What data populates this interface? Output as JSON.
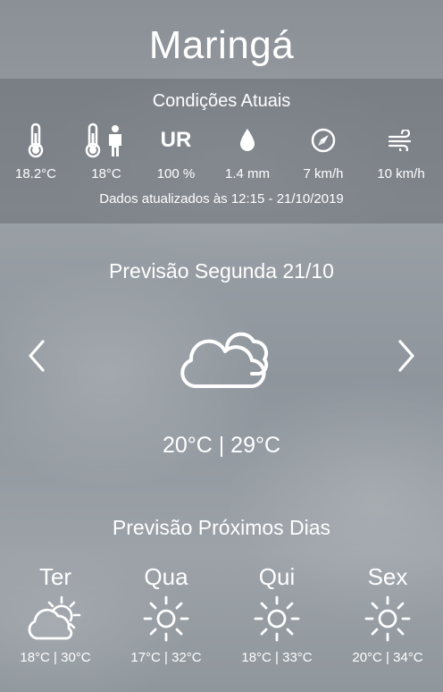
{
  "city": "Maringá",
  "current": {
    "title": "Condições Atuais",
    "metrics": [
      {
        "icon": "thermometer-icon",
        "value": "18.2°C"
      },
      {
        "icon": "feels-like-icon",
        "value": "18°C"
      },
      {
        "icon": "humidity-ur-icon",
        "label": "UR",
        "value": "100 %"
      },
      {
        "icon": "rain-drop-icon",
        "value": "1.4 mm"
      },
      {
        "icon": "wind-direction-icon",
        "value": "7 km/h"
      },
      {
        "icon": "wind-gust-icon",
        "value": "10 km/h"
      }
    ],
    "updated": "Dados atualizados às 12:15 - 21/10/2019"
  },
  "forecast": {
    "title": "Previsão Segunda 21/10",
    "icon": "cloudy-icon",
    "temps": "20°C | 29°C"
  },
  "next_days": {
    "title": "Previsão Próximos Dias",
    "days": [
      {
        "name": "Ter",
        "icon": "partly-cloudy-icon",
        "range": "18°C | 30°C"
      },
      {
        "name": "Qua",
        "icon": "sun-icon",
        "range": "17°C | 32°C"
      },
      {
        "name": "Qui",
        "icon": "sun-icon",
        "range": "18°C | 33°C"
      },
      {
        "name": "Sex",
        "icon": "sun-icon",
        "range": "20°C | 34°C"
      }
    ]
  }
}
